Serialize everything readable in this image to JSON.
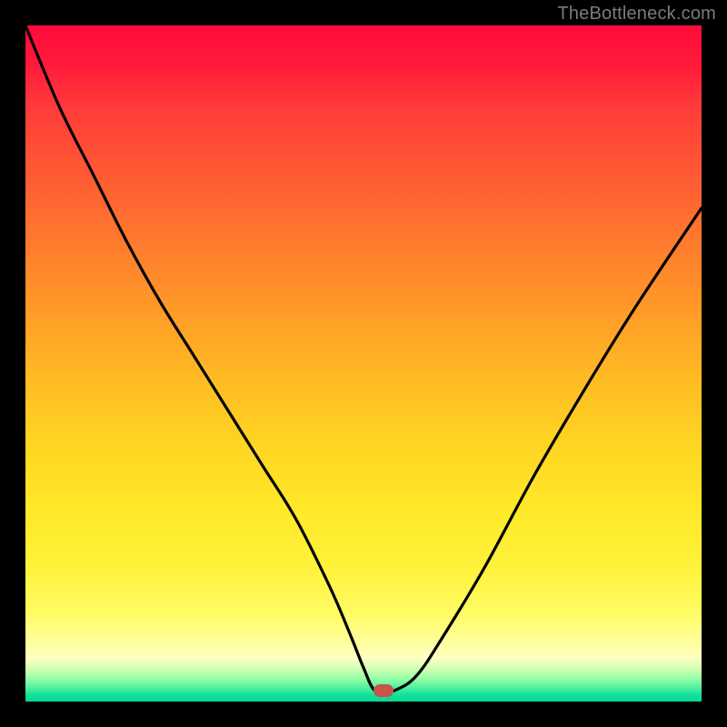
{
  "watermark": "TheBottleneck.com",
  "marker": {
    "x_pct": 53.0,
    "y_pct": 98.4
  },
  "chart_data": {
    "type": "line",
    "title": "",
    "xlabel": "",
    "ylabel": "",
    "xlim": [
      0,
      100
    ],
    "ylim": [
      0,
      100
    ],
    "x": [
      0,
      5,
      10,
      15,
      20,
      25,
      30,
      35,
      40,
      45,
      48,
      50,
      51.5,
      53,
      55,
      58,
      62,
      68,
      75,
      82,
      90,
      100
    ],
    "values": [
      100,
      88,
      78,
      68,
      59,
      51,
      43,
      35,
      27,
      17,
      10,
      5,
      1.8,
      1.5,
      1.8,
      4,
      10,
      20,
      33,
      45,
      58,
      73
    ],
    "grid": false,
    "legend": false,
    "background_gradient": [
      "#ff0a3a",
      "#ff7a2e",
      "#ffe92a",
      "#ffff9a",
      "#0ad492"
    ]
  }
}
